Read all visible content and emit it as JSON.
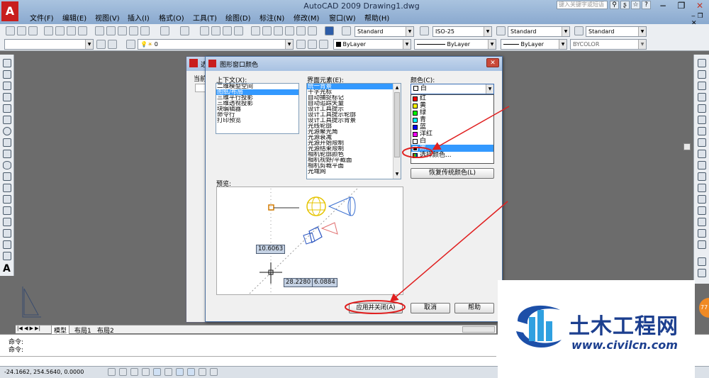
{
  "app": {
    "title": "AutoCAD 2009  Drawing1.dwg",
    "logo_letter": "A",
    "search_placeholder": "键入关键字或短语"
  },
  "menu": [
    "文件(F)",
    "编辑(E)",
    "视图(V)",
    "插入(I)",
    "格式(O)",
    "工具(T)",
    "绘图(D)",
    "标注(N)",
    "修改(M)",
    "窗口(W)",
    "帮助(H)"
  ],
  "toolbar": {
    "text_style": "Standard",
    "dim_style": "ISO-25",
    "table_style": "Standard",
    "multileader_style": "Standard",
    "layer_value": "0",
    "color_value": "ByLayer",
    "linetype_value": "ByLayer",
    "lineweight_value": "ByLayer",
    "plotstyle_value": "BYCOLOR"
  },
  "background_dialog": {
    "title_fragment": "选",
    "label_fragment": "当前"
  },
  "dialog": {
    "title": "图形窗口颜色",
    "context_label": "上下文(X):",
    "context_items": [
      "二维模型空间",
      "图纸/布局",
      "三维平行投影",
      "三维透视投影",
      "块编辑器",
      "命令行",
      "打印预览"
    ],
    "context_selected_index": 1,
    "element_label": "界面元素(E):",
    "element_items": [
      "统一背景",
      "十字光标",
      "自动捕捉标记",
      "自动追踪矢量",
      "设计工具提示",
      "设计工具提示轮廓",
      "设计工具提示背景",
      "光线轮廓",
      "光源聚光角",
      "光源衰减",
      "光源开始限制",
      "光源结束限制",
      "相机轮廓颜色",
      "相机视野/平截面",
      "相机剪裁平面",
      "光域网"
    ],
    "element_selected_index": 0,
    "color_label": "颜色(C):",
    "color_current": "白",
    "color_options": [
      {
        "name": "红",
        "hex": "#ff0000"
      },
      {
        "name": "黄",
        "hex": "#ffff00"
      },
      {
        "name": "绿",
        "hex": "#00ff00"
      },
      {
        "name": "青",
        "hex": "#00ffff"
      },
      {
        "name": "蓝",
        "hex": "#0000ff"
      },
      {
        "name": "洋红",
        "hex": "#ff00ff"
      },
      {
        "name": "白",
        "hex": "#ffffff"
      },
      {
        "name": "黑",
        "hex": "#000000"
      },
      {
        "name": "选择颜色...",
        "hex": "#888888"
      }
    ],
    "color_selected_index": 7,
    "restore_button": "恢复传统颜色(L)",
    "preview_label": "预览:",
    "preview_values": {
      "v1": "10.6063",
      "v2": "28.2280",
      "v3": "6.0884"
    },
    "apply_button": "应用并关闭(A)",
    "cancel_button": "取消",
    "help_button": "帮助"
  },
  "layout_tabs": [
    "模型",
    "布局1",
    "布局2"
  ],
  "command_lines": [
    "命令:",
    "命令:"
  ],
  "status": {
    "coords": "-24.1662,  254.5640,  0.0000"
  },
  "watermark": {
    "name": "土木工程网",
    "url": "www.civilcn.com"
  },
  "colors": {
    "accent": "#3399ff",
    "annotation": "#e02020",
    "title_bar": "#a9c3df"
  }
}
